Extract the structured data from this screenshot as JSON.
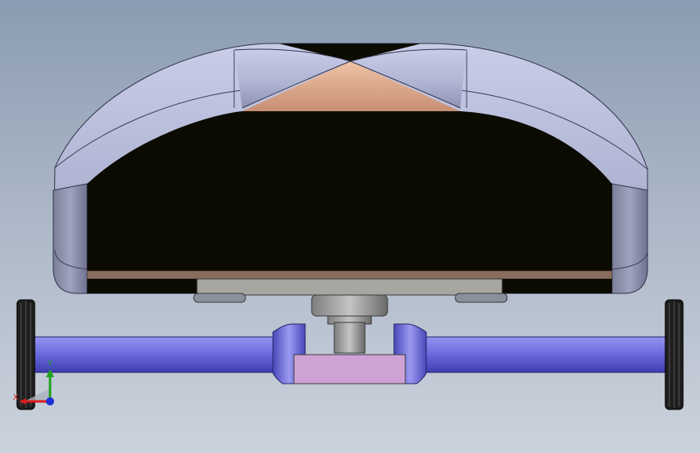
{
  "viewport": {
    "background_top": "#8b9cb2",
    "background_bottom": "#cbd2dc"
  },
  "triad": {
    "x_label": "X",
    "y_label": "Y",
    "x_color": "#d81c1c",
    "y_color": "#1fa01f",
    "z_color": "#1c2fd8"
  },
  "colors": {
    "shell": "#b9bedb",
    "cavity": "#0c0b02",
    "copper": "#d9a58a",
    "axle": "#6f6fe0",
    "block": "#cfa2d6",
    "tray": "#a8a6a0",
    "wheel": "#2a2a2a"
  }
}
